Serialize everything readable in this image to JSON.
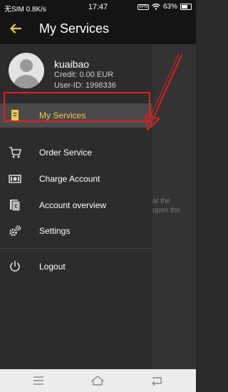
{
  "status_bar": {
    "carrier": "无SIM 0.8K/s",
    "time": "17:47",
    "vpn": "VPN",
    "battery": "63%"
  },
  "app_bar": {
    "title": "My Services"
  },
  "profile": {
    "username": "kuaibao",
    "credit": "Credit: 0.00 EUR",
    "user_id": "User-ID: 1998336"
  },
  "menu": {
    "items": [
      {
        "label": "My Services",
        "icon": "services-icon",
        "active": true
      },
      {
        "label": "Order Service",
        "icon": "cart-icon"
      },
      {
        "label": "Charge Account",
        "icon": "money-icon"
      },
      {
        "label": "Account overview",
        "icon": "account-overview-icon"
      },
      {
        "label": "Settings",
        "icon": "gears-icon"
      },
      {
        "label": "Logout",
        "icon": "power-icon"
      }
    ]
  },
  "background_text": {
    "line1": "at the",
    "line2": "open the"
  },
  "colors": {
    "accent": "#f2c94c",
    "highlight": "#e0201d",
    "drawer_bg": "#2c2c2c",
    "bar_bg": "#141414"
  }
}
